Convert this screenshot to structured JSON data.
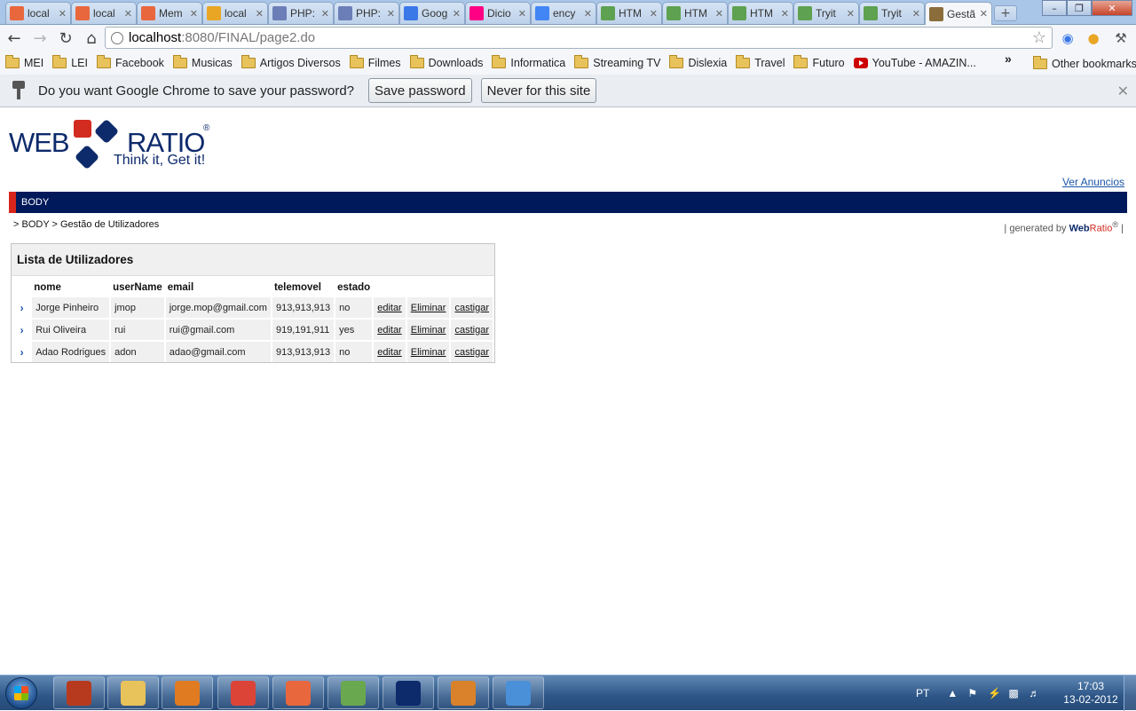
{
  "browser": {
    "tabs": [
      {
        "title": "local",
        "icon": "xampp-icon",
        "color": "#e8673d"
      },
      {
        "title": "local",
        "icon": "xampp-icon",
        "color": "#e8673d"
      },
      {
        "title": "Mem",
        "icon": "xampp-icon",
        "color": "#e8673d"
      },
      {
        "title": "local",
        "icon": "phpmyadmin-icon",
        "color": "#e9a625"
      },
      {
        "title": "PHP:",
        "icon": "php-icon",
        "color": "#6c7eb7"
      },
      {
        "title": "PHP:",
        "icon": "php-icon",
        "color": "#6c7eb7"
      },
      {
        "title": "Goog",
        "icon": "translate-icon",
        "color": "#3b78e7"
      },
      {
        "title": "Dicio",
        "icon": "flickr-icon",
        "color": "#ff0084"
      },
      {
        "title": "ency",
        "icon": "google-icon",
        "color": "#4285f4"
      },
      {
        "title": "HTM",
        "icon": "w3-icon",
        "color": "#5ea150"
      },
      {
        "title": "HTM",
        "icon": "w3-icon",
        "color": "#5ea150"
      },
      {
        "title": "HTM",
        "icon": "w3-icon",
        "color": "#5ea150"
      },
      {
        "title": "Tryit",
        "icon": "w3-icon",
        "color": "#5ea150"
      },
      {
        "title": "Tryit",
        "icon": "w3-icon",
        "color": "#5ea150"
      },
      {
        "title": "Gestã",
        "icon": "page-icon",
        "color": "#8a6d3b",
        "active": true
      }
    ],
    "url_host": "localhost",
    "url_path": ":8080/FINAL/page2.do",
    "bookmarks": [
      "MEI",
      "LEI",
      "Facebook",
      "Musicas",
      "Artigos Diversos",
      "Filmes",
      "Downloads",
      "Informatica",
      "Streaming TV",
      "Dislexia",
      "Travel",
      "Futuro"
    ],
    "bookmark_youtube": "YouTube - AMAZIN...",
    "bookmark_more": "»",
    "other_bookmarks": "Other bookmarks",
    "infobar": {
      "message": "Do you want Google Chrome to save your password?",
      "save_label": "Save password",
      "never_label": "Never for this site"
    }
  },
  "page": {
    "logo": {
      "web": "WEB",
      "ratio": "RATIO",
      "reg": "®",
      "tagline": "Think it, Get it!"
    },
    "ver_anuncios": "Ver Anuncios",
    "nav_label": "BODY",
    "breadcrumb": "> BODY > Gestão de Utilizadores",
    "generated_prefix": "| generated by",
    "generated_web": "Web",
    "generated_ratio": "Ratio",
    "generated_reg": "®",
    "generated_suffix": "|",
    "panel_title": "Lista de Utilizadores",
    "columns": [
      "nome",
      "userName",
      "email",
      "telemovel",
      "estado"
    ],
    "action_labels": {
      "edit": "editar",
      "delete": "Eliminar",
      "punish": "castigar"
    },
    "rows": [
      {
        "nome": "Jorge Pinheiro",
        "userName": "jmop",
        "email": "jorge.mop@gmail.com",
        "telemovel": "913,913,913",
        "estado": "no"
      },
      {
        "nome": "Rui Oliveira",
        "userName": "rui",
        "email": "rui@gmail.com",
        "telemovel": "919,191,911",
        "estado": "yes"
      },
      {
        "nome": "Adao Rodrigues",
        "userName": "adon",
        "email": "adao@gmail.com",
        "telemovel": "913,913,913",
        "estado": "no"
      }
    ]
  },
  "taskbar": {
    "language": "PT",
    "time": "17:03",
    "date": "13-02-2012",
    "apps": [
      {
        "name": "winrar-icon",
        "color": "#b83a1e"
      },
      {
        "name": "explorer-icon",
        "color": "#e8c25a"
      },
      {
        "name": "media-player-icon",
        "color": "#e07b22"
      },
      {
        "name": "chrome-icon",
        "color": "#db4437"
      },
      {
        "name": "xampp-icon",
        "color": "#e8673d"
      },
      {
        "name": "notepad-icon",
        "color": "#6aa84f"
      },
      {
        "name": "webratio-icon",
        "color": "#0d2a6b"
      },
      {
        "name": "java-icon",
        "color": "#d9822b"
      },
      {
        "name": "paint-icon",
        "color": "#4a90d9"
      }
    ]
  }
}
